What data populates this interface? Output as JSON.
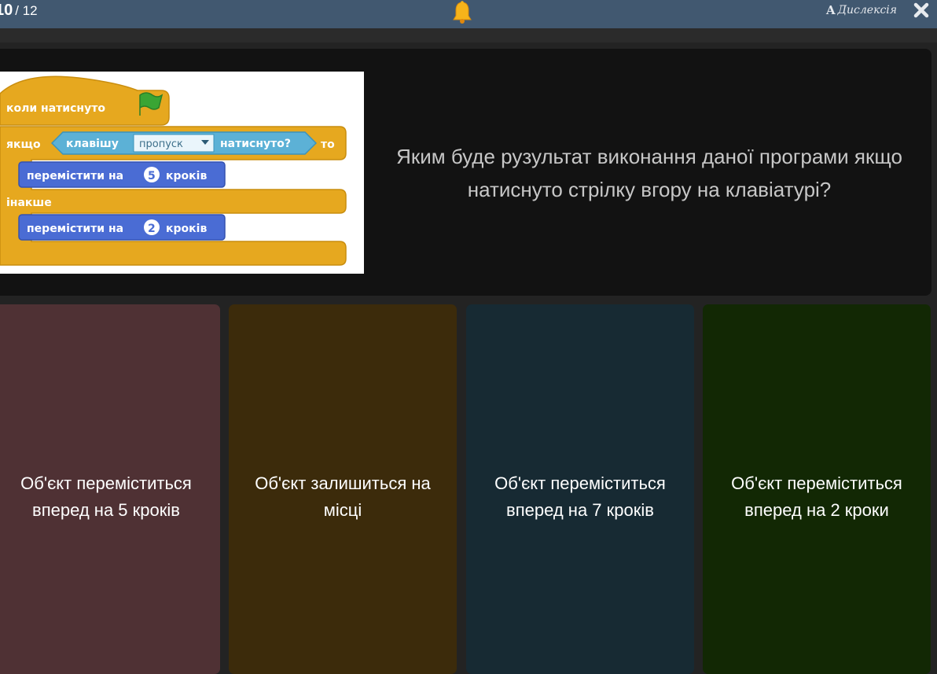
{
  "header": {
    "current": "10",
    "total": "/ 12",
    "dyslexia_glyph": "A",
    "dyslexia_label": "Дислексія"
  },
  "question": {
    "text": "Яким буде рузультат виконання даної програми якщо натиснуто стрілку вгору на клавіатурі?",
    "code_blocks": {
      "when_clicked": "коли натиснуто",
      "if": "якщо",
      "key": "клавішу",
      "key_value": "пропуск",
      "pressed": "натиснуто?",
      "then": "то",
      "move1_prefix": "перемістити на",
      "move1_steps": "5",
      "move_suffix": "кроків",
      "else": "інакше",
      "move2_prefix": "перемістити на",
      "move2_steps": "2"
    }
  },
  "answers": [
    {
      "label": "Об'єкт переміститься вперед на 5 кроків",
      "color": "#4f3134"
    },
    {
      "label": "Об'єкт залишиться на місці",
      "color": "#3c2b0b"
    },
    {
      "label": "Об'єкт переміститься вперед на 7 кроків",
      "color": "#172a33"
    },
    {
      "label": "Об'єкт переміститься вперед на 2 кроки",
      "color": "#122804"
    }
  ],
  "colors": {
    "topbar": "#415870",
    "question_card": "#121212",
    "scratch_control": "#e6a81f",
    "scratch_sensing": "#5cb1d6",
    "scratch_motion": "#4a6cd4"
  },
  "icons": {
    "bell": "bell-icon",
    "close": "close-icon",
    "flag": "green-flag-icon"
  }
}
